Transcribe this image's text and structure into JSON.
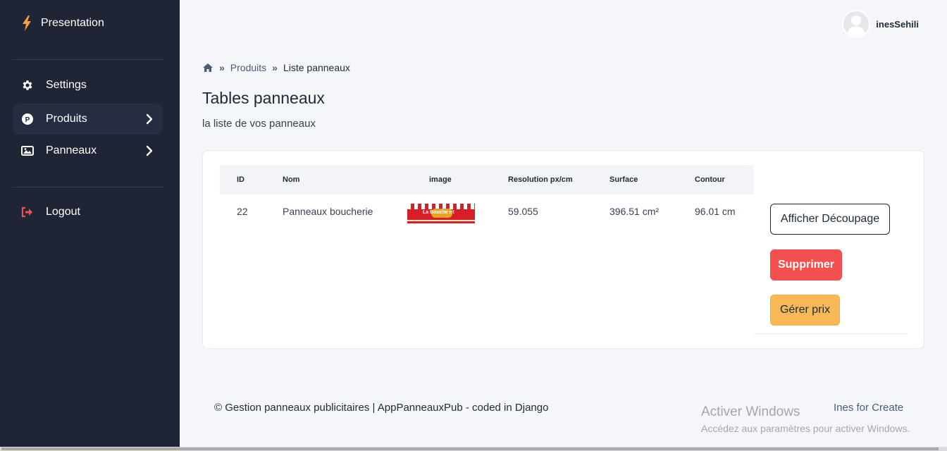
{
  "sidebar": {
    "brand": "Presentation",
    "items": [
      {
        "label": "Settings",
        "icon": "gear-icon"
      },
      {
        "label": "Produits",
        "icon": "p-circle-icon",
        "active": true
      },
      {
        "label": "Panneaux",
        "icon": "image-icon"
      },
      {
        "label": "Logout",
        "icon": "logout-icon"
      }
    ]
  },
  "topbar": {
    "username": "inesSehili"
  },
  "breadcrumb": {
    "home_icon": "home-icon",
    "items": [
      "Produits",
      "Liste panneaux"
    ]
  },
  "page": {
    "title": "Tables panneaux",
    "subtitle": "la liste de vos panneaux"
  },
  "table": {
    "headers": [
      "ID",
      "Nom",
      "image",
      "Resolution px/cm",
      "Surface",
      "Contour"
    ],
    "rows": [
      {
        "id": "22",
        "nom": "Panneaux boucherie",
        "image_text": "La Bouche rit",
        "resolution": "59.055",
        "surface": "396.51 cm²",
        "contour": "96.01 cm"
      }
    ]
  },
  "actions": {
    "afficher": "Afficher Découpage",
    "supprimer": "Supprimer",
    "gerer": "Gérer prix"
  },
  "footer": {
    "text": "© Gestion panneaux publicitaires | AppPanneauxPub - coded in Django",
    "right": "Ines for Create"
  },
  "windows_watermark": {
    "title": "Activer Windows",
    "sub": "Accédez aux paramètres pour activer Windows."
  },
  "colors": {
    "sidebar": "#1f2535",
    "danger": "#f55050",
    "warning": "#f6b955",
    "logout": "#f55050",
    "bolt": "#f6a03c"
  }
}
